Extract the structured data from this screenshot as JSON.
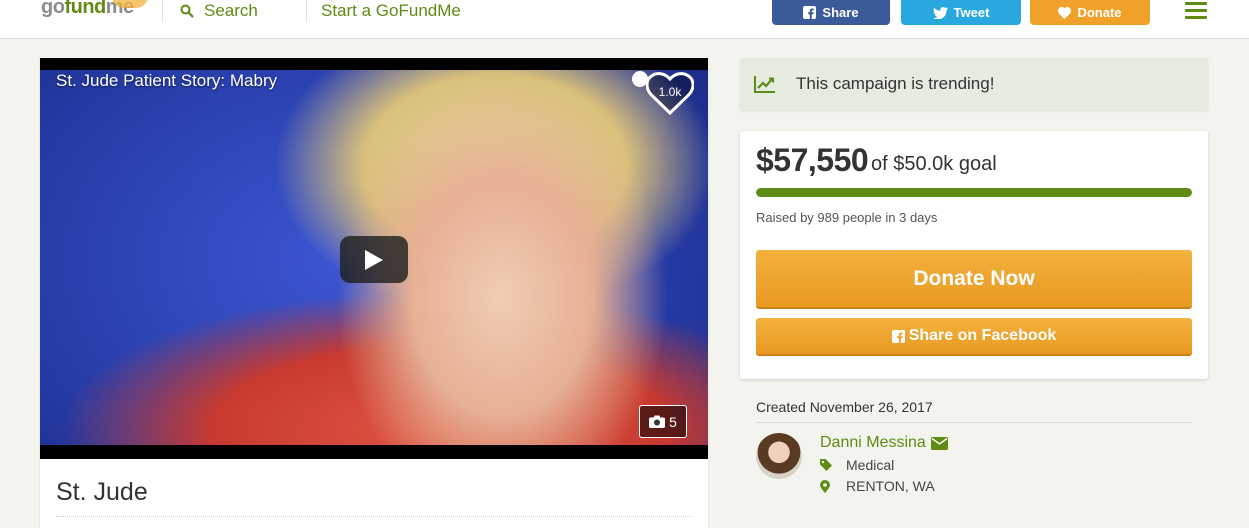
{
  "header": {
    "logo": {
      "go": "go",
      "fund": "fund",
      "me": "me"
    },
    "search_label": "Search",
    "start_label": "Start a GoFundMe",
    "share_label": "Share",
    "tweet_label": "Tweet",
    "donate_label": "Donate",
    "colors": {
      "facebook": "#3b5a9a",
      "twitter": "#29a8e0",
      "donate": "#efa12a",
      "brand_green": "#5e8b13"
    }
  },
  "video": {
    "title": "St. Jude Patient Story: Mabry",
    "heart_count": "1.0k",
    "photo_count": "5",
    "icons": [
      "clock-icon",
      "heart-icon",
      "play-icon",
      "camera-icon"
    ]
  },
  "campaign": {
    "title": "St. Jude",
    "trending_text": "This campaign is trending!",
    "amount_raised": "$57,550",
    "goal_text": "of $50.0k goal",
    "progress_fraction": 1.0,
    "raised_by": "Raised by 989 people in 3 days",
    "donate_now_label": "Donate Now",
    "share_facebook_label": "Share on Facebook",
    "created": "Created November 26, 2017"
  },
  "organizer": {
    "name": "Danni Messina",
    "category": "Medical",
    "location": "RENTON, WA"
  }
}
